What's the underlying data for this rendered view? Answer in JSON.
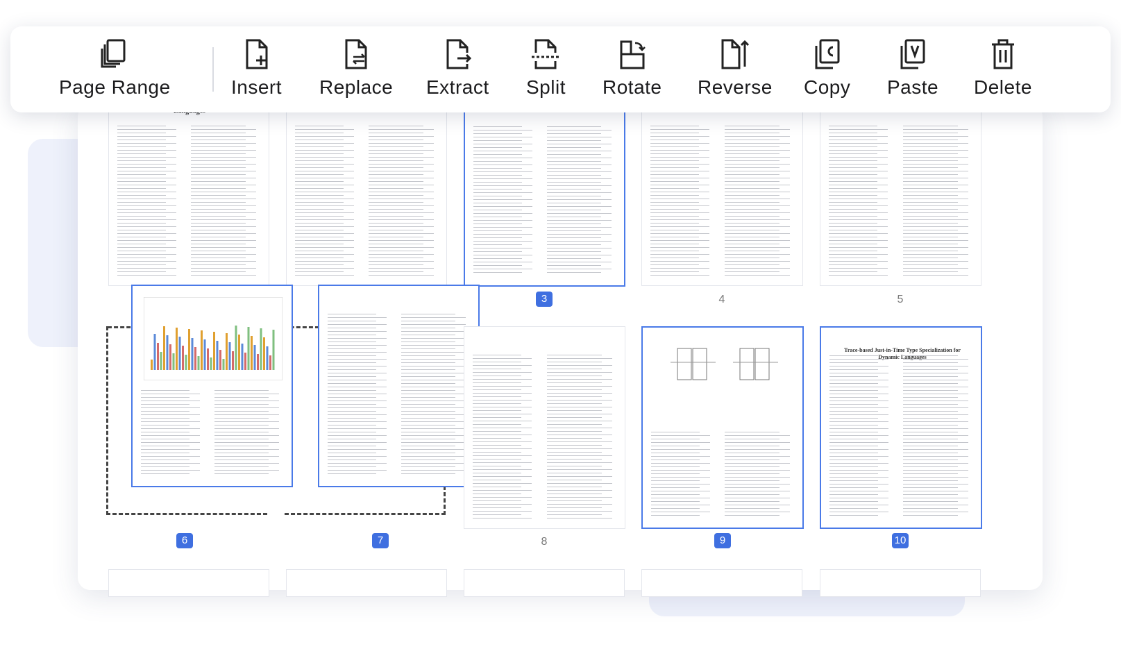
{
  "toolbar": {
    "tools": [
      {
        "label": "Page Range",
        "icon": "page-range-icon"
      },
      {
        "label": "Insert",
        "icon": "insert-page-icon"
      },
      {
        "label": "Replace",
        "icon": "replace-page-icon"
      },
      {
        "label": "Extract",
        "icon": "extract-page-icon"
      },
      {
        "label": "Split",
        "icon": "split-page-icon"
      },
      {
        "label": "Rotate",
        "icon": "rotate-page-icon"
      },
      {
        "label": "Reverse",
        "icon": "reverse-pages-icon"
      },
      {
        "label": "Copy",
        "icon": "copy-page-icon"
      },
      {
        "label": "Paste",
        "icon": "paste-page-icon"
      },
      {
        "label": "Delete",
        "icon": "delete-page-icon"
      }
    ]
  },
  "pages": [
    {
      "number": "3",
      "selected": true
    },
    {
      "number": "4",
      "selected": false
    },
    {
      "number": "5",
      "selected": false
    },
    {
      "number": "6",
      "selected": true
    },
    {
      "number": "7",
      "selected": true
    },
    {
      "number": "8",
      "selected": false
    },
    {
      "number": "9",
      "selected": true
    },
    {
      "number": "10",
      "selected": true
    }
  ],
  "page_titles": {
    "page1_heading": "Languages",
    "page10_title": "Trace-based Just-in-Time Type Specialization for Dynamic Languages"
  },
  "colors": {
    "accent": "#3f6fe0",
    "selection_border": "#4a7ae8"
  }
}
